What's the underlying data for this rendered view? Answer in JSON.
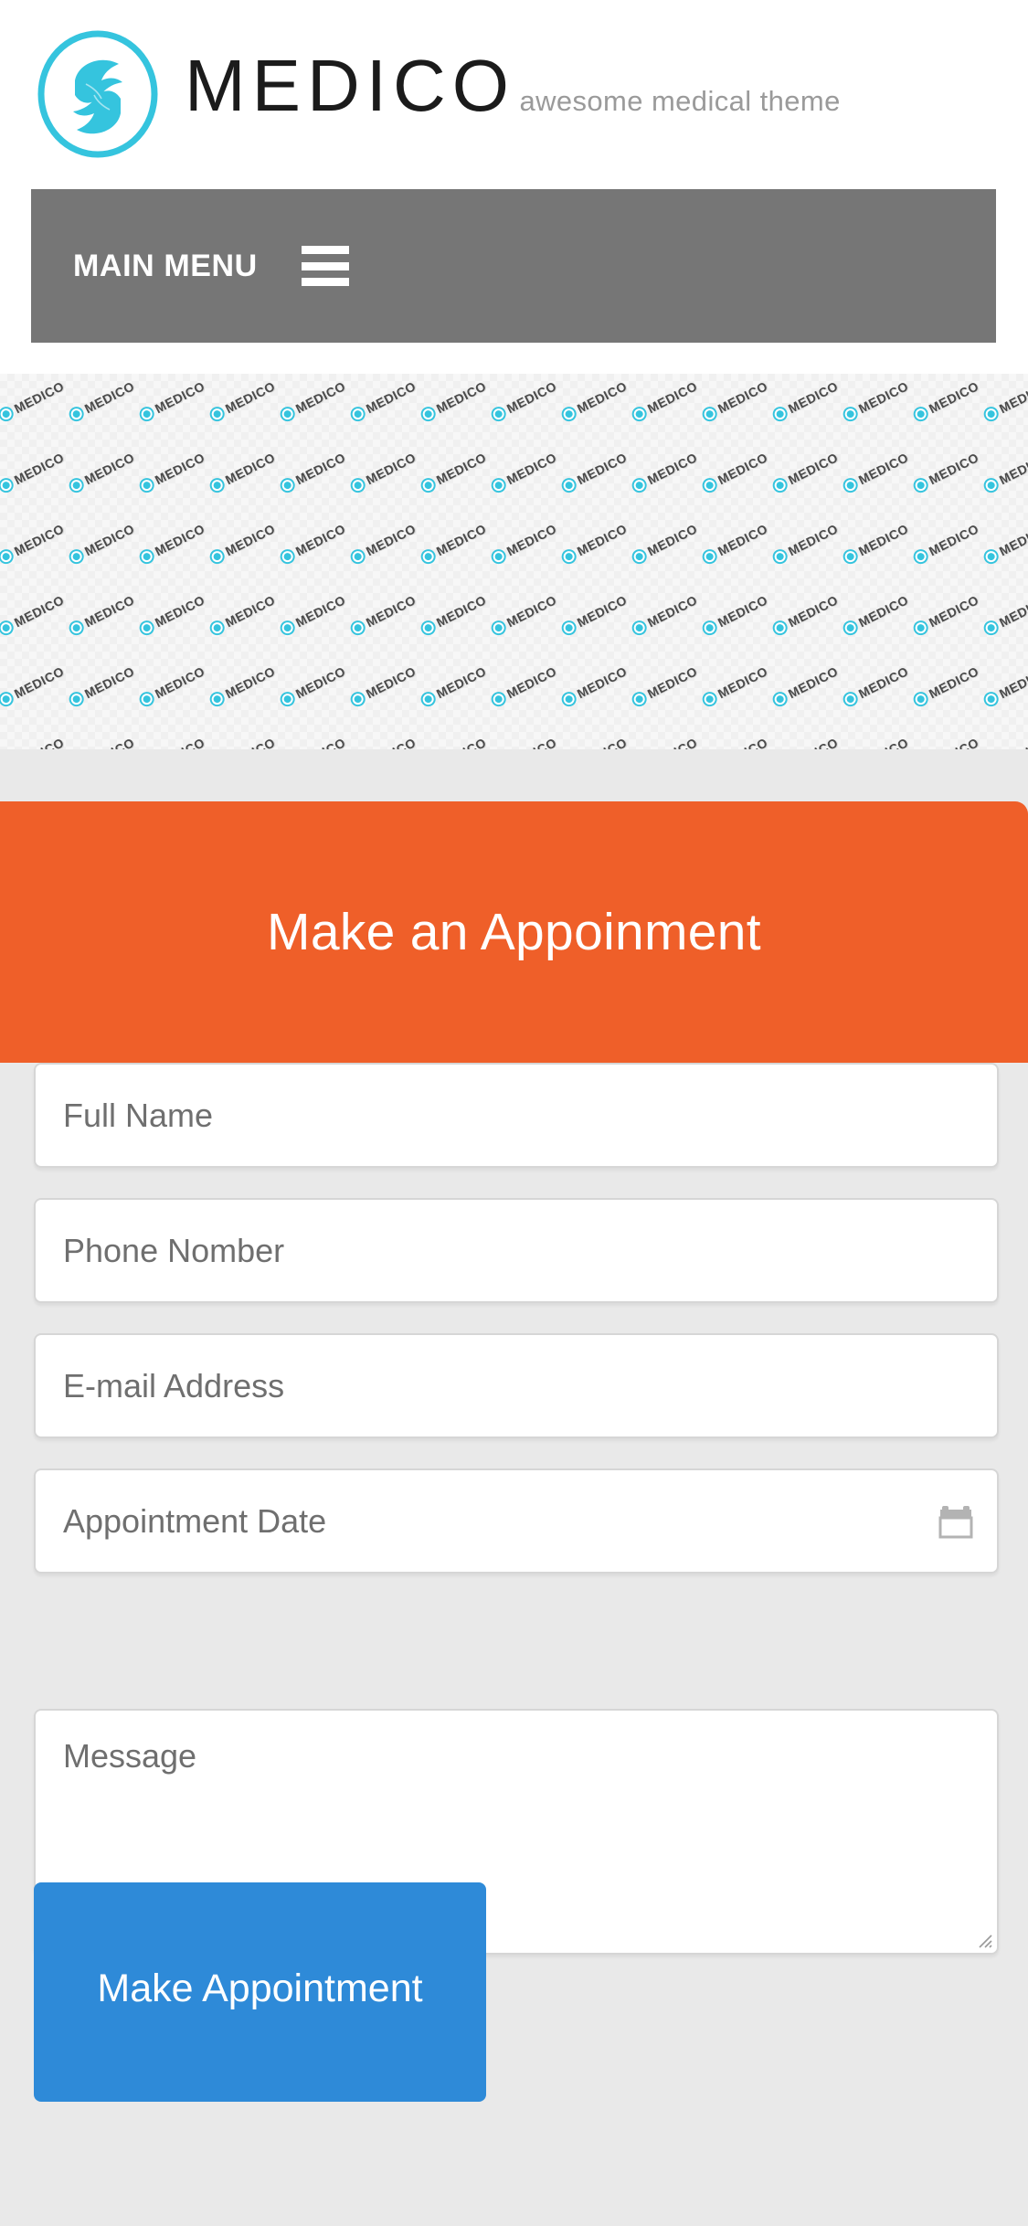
{
  "brand": {
    "name": "MEDICO",
    "tagline": "awesome medical theme",
    "logo_icon": "medico-leaf-circle-icon",
    "accent_color": "#35c4de"
  },
  "nav": {
    "label": "MAIN MENU",
    "toggle_icon": "hamburger-menu-icon",
    "background_color": "#767676"
  },
  "hero": {
    "pattern_word": "MEDICO",
    "pattern_badge_icon": "medico-badge-icon",
    "background_color": "#f7f7f7"
  },
  "appointment": {
    "heading": "Make an Appoinment",
    "heading_background_color": "#ef5f29",
    "fields": [
      {
        "name": "full-name",
        "placeholder": "Full Name",
        "value": "",
        "type": "text"
      },
      {
        "name": "phone-number",
        "placeholder": "Phone Nomber",
        "value": "",
        "type": "text"
      },
      {
        "name": "email-address",
        "placeholder": "E-mail Address",
        "value": "",
        "type": "text"
      },
      {
        "name": "appointment-date",
        "placeholder": "Appointment Date",
        "value": "",
        "type": "date",
        "icon": "calendar-icon"
      }
    ],
    "message": {
      "name": "message",
      "placeholder": "Message",
      "value": ""
    },
    "submit": {
      "label": "Make Appointment",
      "background_color": "#2e8ad8"
    }
  },
  "page": {
    "background_color": "#e9e9e9"
  }
}
